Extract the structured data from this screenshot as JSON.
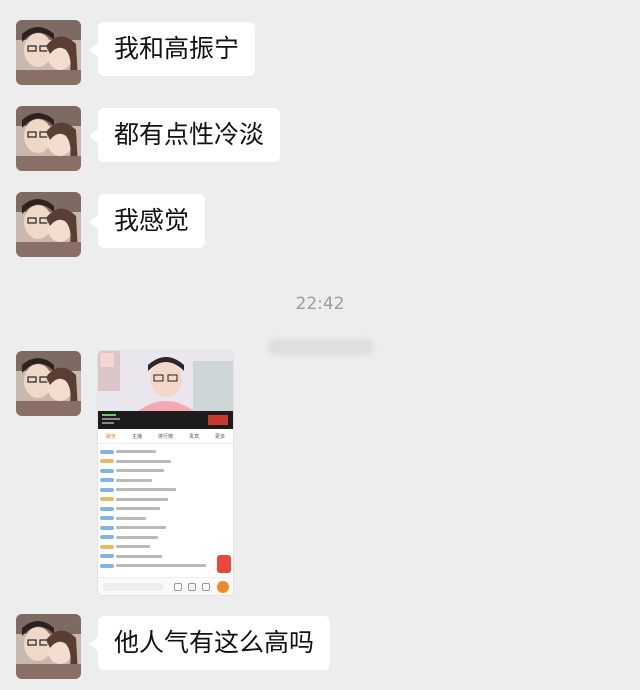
{
  "messages": [
    {
      "sender": "contact",
      "text": "我和高振宁"
    },
    {
      "sender": "contact",
      "text": "都有点性冷淡"
    },
    {
      "sender": "contact",
      "text": "我感觉"
    },
    {
      "sender": "contact",
      "text": "他人气有这么高吗"
    }
  ],
  "timestamp": "22:42",
  "shared_image": {
    "type": "live-stream-screenshot",
    "tabs": [
      "聊天",
      "主播",
      "排行榜",
      "贵宾",
      "更多"
    ],
    "active_tab": 0
  },
  "colors": {
    "background": "#ededed",
    "bubble": "#ffffff",
    "timestamp": "#9c9c9c",
    "accent": "#e07b1a"
  }
}
